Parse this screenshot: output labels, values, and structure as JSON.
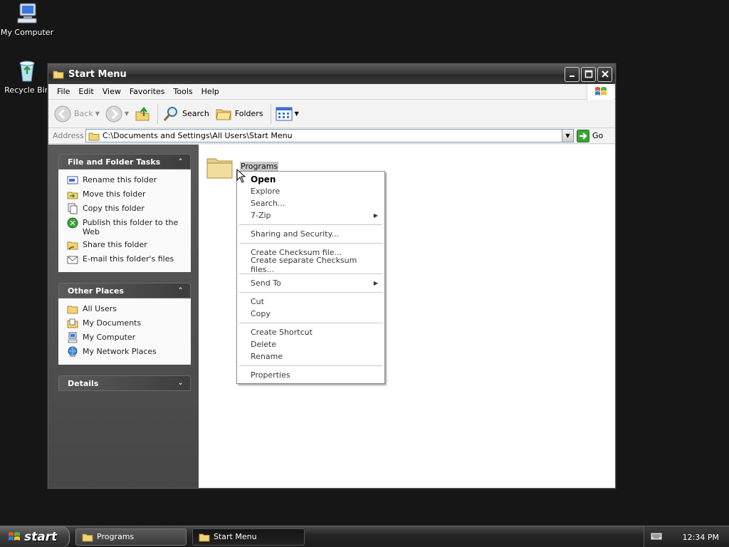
{
  "desktop": {
    "icons": [
      {
        "label": "My Computer",
        "icon": "my-computer-icon"
      },
      {
        "label": "Recycle Bin",
        "icon": "recycle-bin-icon"
      }
    ]
  },
  "window": {
    "title": "Start Menu",
    "menu": [
      "File",
      "Edit",
      "View",
      "Favorites",
      "Tools",
      "Help"
    ],
    "toolbar": {
      "back": "Back",
      "search": "Search",
      "folders": "Folders"
    },
    "address": {
      "label": "Address",
      "value": "C:\\Documents and Settings\\All Users\\Start Menu",
      "go": "Go"
    }
  },
  "sidebar": {
    "file_tasks": {
      "title": "File and Folder Tasks",
      "items": [
        "Rename this folder",
        "Move this folder",
        "Copy this folder",
        "Publish this folder to the Web",
        "Share this folder",
        "E-mail this folder's files"
      ]
    },
    "other_places": {
      "title": "Other Places",
      "items": [
        "All Users",
        "My Documents",
        "My Computer",
        "My Network Places"
      ]
    },
    "details": {
      "title": "Details"
    }
  },
  "main": {
    "folder_name": "Programs"
  },
  "context_menu": {
    "groups": [
      [
        "Open",
        "Explore",
        "Search...",
        "7-Zip"
      ],
      [
        "Sharing and Security..."
      ],
      [
        "Create Checksum file...",
        "Create separate Checksum files..."
      ],
      [
        "Send To"
      ],
      [
        "Cut",
        "Copy"
      ],
      [
        "Create Shortcut",
        "Delete",
        "Rename"
      ],
      [
        "Properties"
      ]
    ]
  },
  "taskbar": {
    "start": "start",
    "buttons": [
      "Programs",
      "Start Menu"
    ],
    "active_button": "Start Menu",
    "clock": "12:34 PM"
  }
}
